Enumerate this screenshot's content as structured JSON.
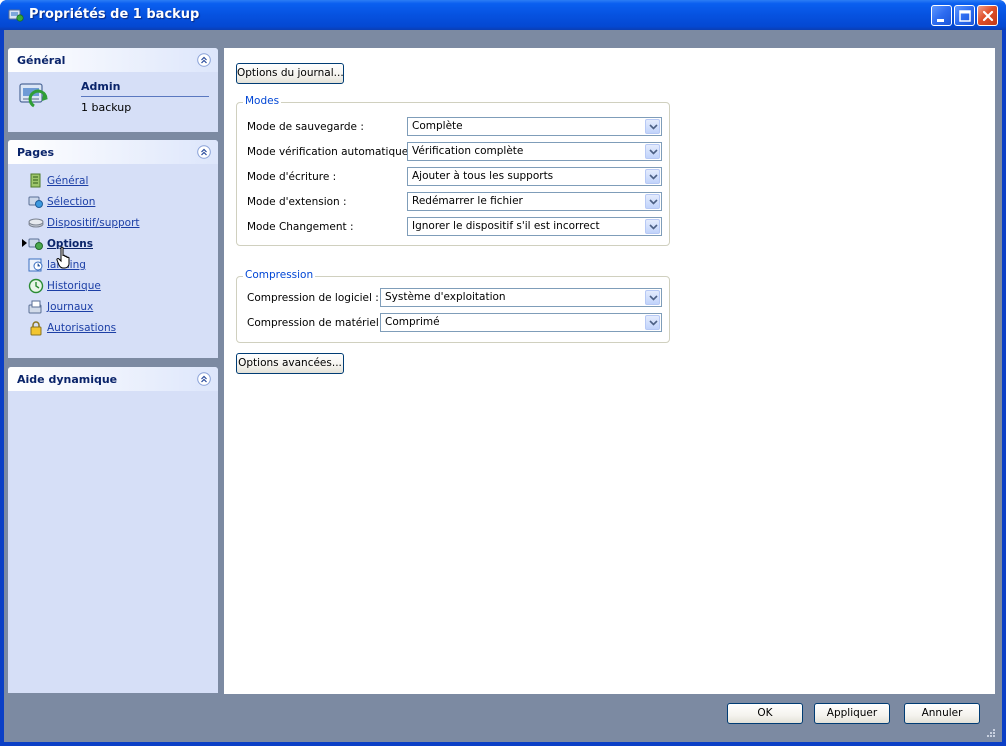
{
  "window": {
    "title": "Propriétés de 1 backup",
    "colors": {
      "titlebar": "#0652e0",
      "frame": "#0b3fc6",
      "client": "#7c8aa2",
      "pane": "#d6dff7",
      "legend": "#0046d5"
    }
  },
  "general_pane": {
    "title": "Général",
    "user": "Admin",
    "job": "1 backup",
    "icon": "backup-job-icon"
  },
  "pages_pane": {
    "title": "Pages",
    "items": [
      {
        "label": "Général",
        "icon": "document-icon"
      },
      {
        "label": "Sélection",
        "icon": "selection-icon"
      },
      {
        "label": "Dispositif/support",
        "icon": "device-icon"
      },
      {
        "label": "Options",
        "icon": "options-icon",
        "active": true
      },
      {
        "label": "lanning",
        "icon": "planning-icon"
      },
      {
        "label": "Historique",
        "icon": "history-icon"
      },
      {
        "label": "Journaux",
        "icon": "logs-icon"
      },
      {
        "label": "Autorisations",
        "icon": "lock-icon"
      }
    ]
  },
  "help_pane": {
    "title": "Aide dynamique"
  },
  "content": {
    "log_options_button": "Options du journal...",
    "modes": {
      "legend": "Modes",
      "rows": [
        {
          "label": "Mode de sauvegarde :",
          "value": "Complète"
        },
        {
          "label": "Mode vérification automatique :",
          "value": "Vérification complète"
        },
        {
          "label": "Mode d'écriture :",
          "value": "Ajouter à tous les supports"
        },
        {
          "label": "Mode d'extension :",
          "value": "Redémarrer le fichier"
        },
        {
          "label": "Mode Changement :",
          "value": "Ignorer le dispositif s'il est incorrect"
        }
      ]
    },
    "compression": {
      "legend": "Compression",
      "rows": [
        {
          "label": "Compression de logiciel :",
          "value": "Système d'exploitation"
        },
        {
          "label": "Compression de matériel :",
          "value": "Comprimé"
        }
      ]
    },
    "advanced_options_button": "Options avancées..."
  },
  "footer": {
    "ok": "OK",
    "apply": "Appliquer",
    "cancel": "Annuler"
  }
}
